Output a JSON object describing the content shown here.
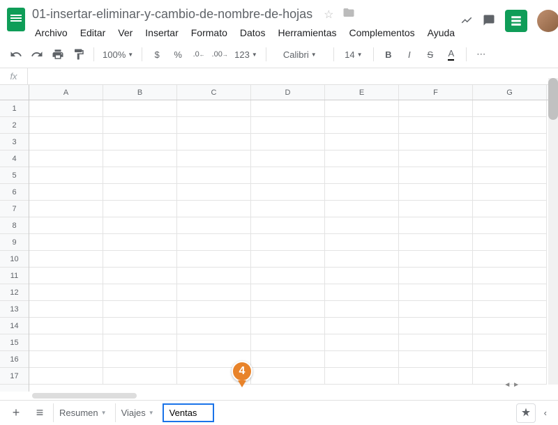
{
  "doc": {
    "title": "01-insertar-eliminar-y-cambio-de-nombre-de-hojas"
  },
  "menu": {
    "items": [
      "Archivo",
      "Editar",
      "Ver",
      "Insertar",
      "Formato",
      "Datos",
      "Herramientas",
      "Complementos",
      "Ayuda"
    ]
  },
  "toolbar": {
    "zoom": "100%",
    "currency": "$",
    "percent": "%",
    "dec_dec": ".0",
    "dec_inc": ".00",
    "more_fmt": "123",
    "font": "Calibri",
    "size": "14",
    "bold": "B",
    "italic": "I",
    "strike": "S",
    "color": "A",
    "more": "⋯"
  },
  "formula": {
    "fx": "fx",
    "value": ""
  },
  "columns": [
    "A",
    "B",
    "C",
    "D",
    "E",
    "F",
    "G"
  ],
  "rows": [
    "1",
    "2",
    "3",
    "4",
    "5",
    "6",
    "7",
    "8",
    "9",
    "10",
    "11",
    "12",
    "13",
    "14",
    "15",
    "16",
    "17"
  ],
  "sheets": {
    "add": "+",
    "all": "≡",
    "tab1": "Resumen",
    "tab2": "Viajes",
    "tab3_editing": "Ventas"
  },
  "callout": {
    "num": "4"
  }
}
